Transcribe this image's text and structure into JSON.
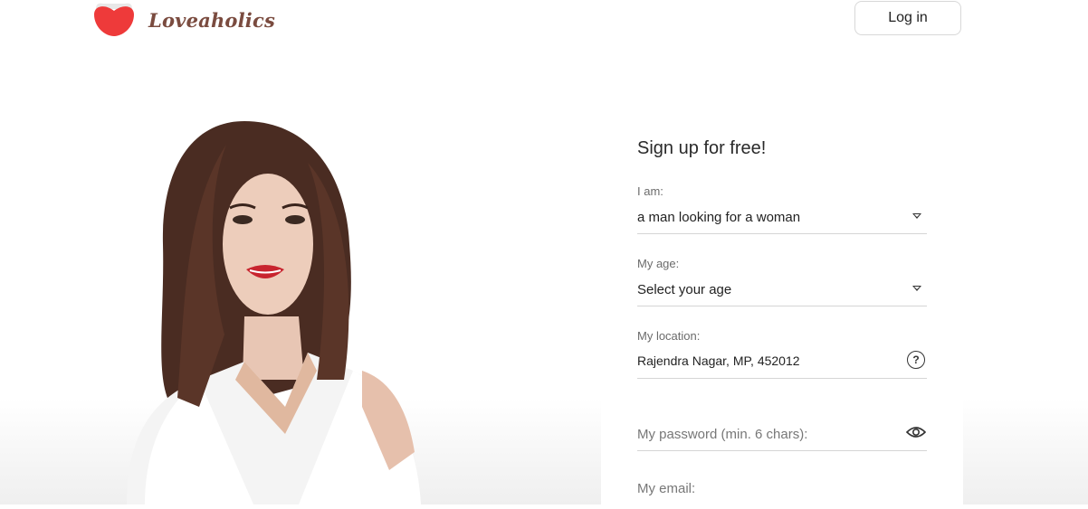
{
  "header": {
    "brand": "Loveaholics",
    "login_label": "Log in"
  },
  "colors": {
    "brand_red": "#ee3a3a",
    "brand_text": "#7a4b3f"
  },
  "form": {
    "title": "Sign up for free!",
    "gender": {
      "label": "I am:",
      "value": "a man looking for a woman"
    },
    "age": {
      "label": "My age:",
      "value": "Select your age"
    },
    "location": {
      "label": "My location:",
      "value": "Rajendra Nagar, MP, 452012"
    },
    "password": {
      "placeholder": "My password (min. 6 chars):"
    },
    "email": {
      "placeholder": "My email:"
    }
  },
  "icons": {
    "logo": "heart-icon",
    "dropdown": "chevron-down-icon",
    "help": "question-circle-icon",
    "show_password": "eye-icon"
  }
}
